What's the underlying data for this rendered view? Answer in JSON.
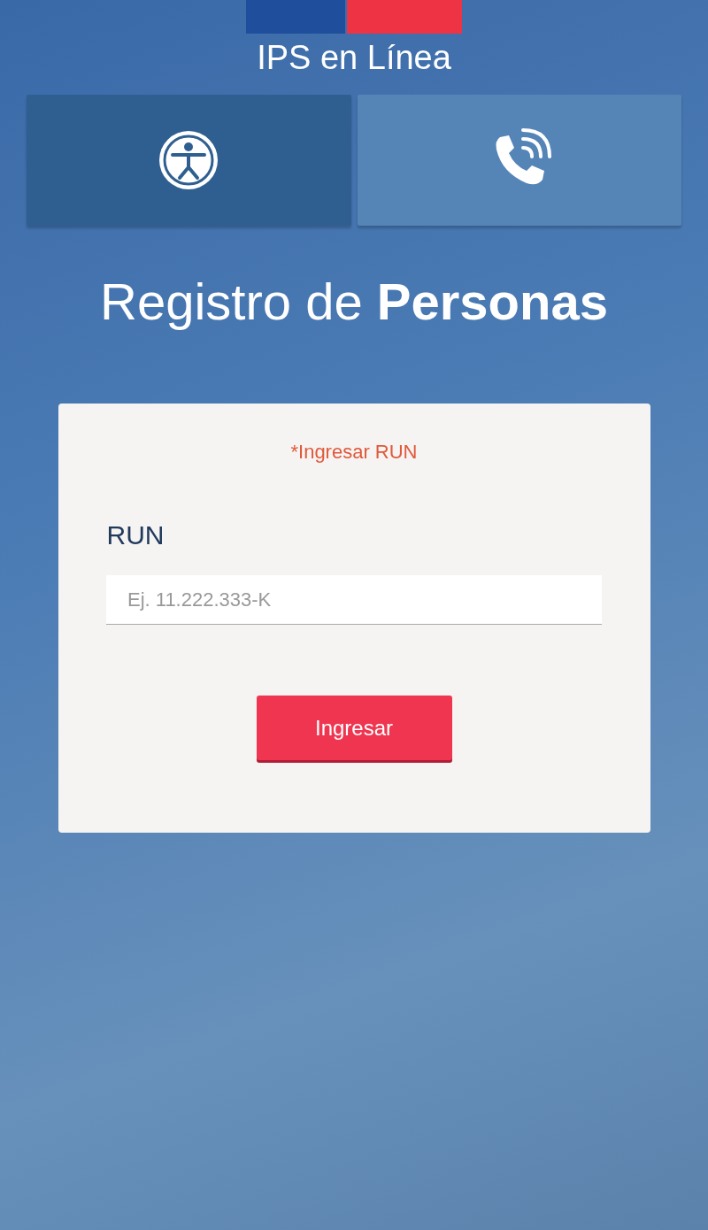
{
  "header": {
    "title": "IPS en Línea"
  },
  "tiles": [
    {
      "kind": "accessibility",
      "selected": true
    },
    {
      "kind": "phone",
      "selected": false
    }
  ],
  "heading": "Registro de **Personas**",
  "form": {
    "error": "*Ingresar RUN",
    "label": "RUN",
    "placeholder": "Ej. 11.222.333-K",
    "button": "Ingresar"
  }
}
